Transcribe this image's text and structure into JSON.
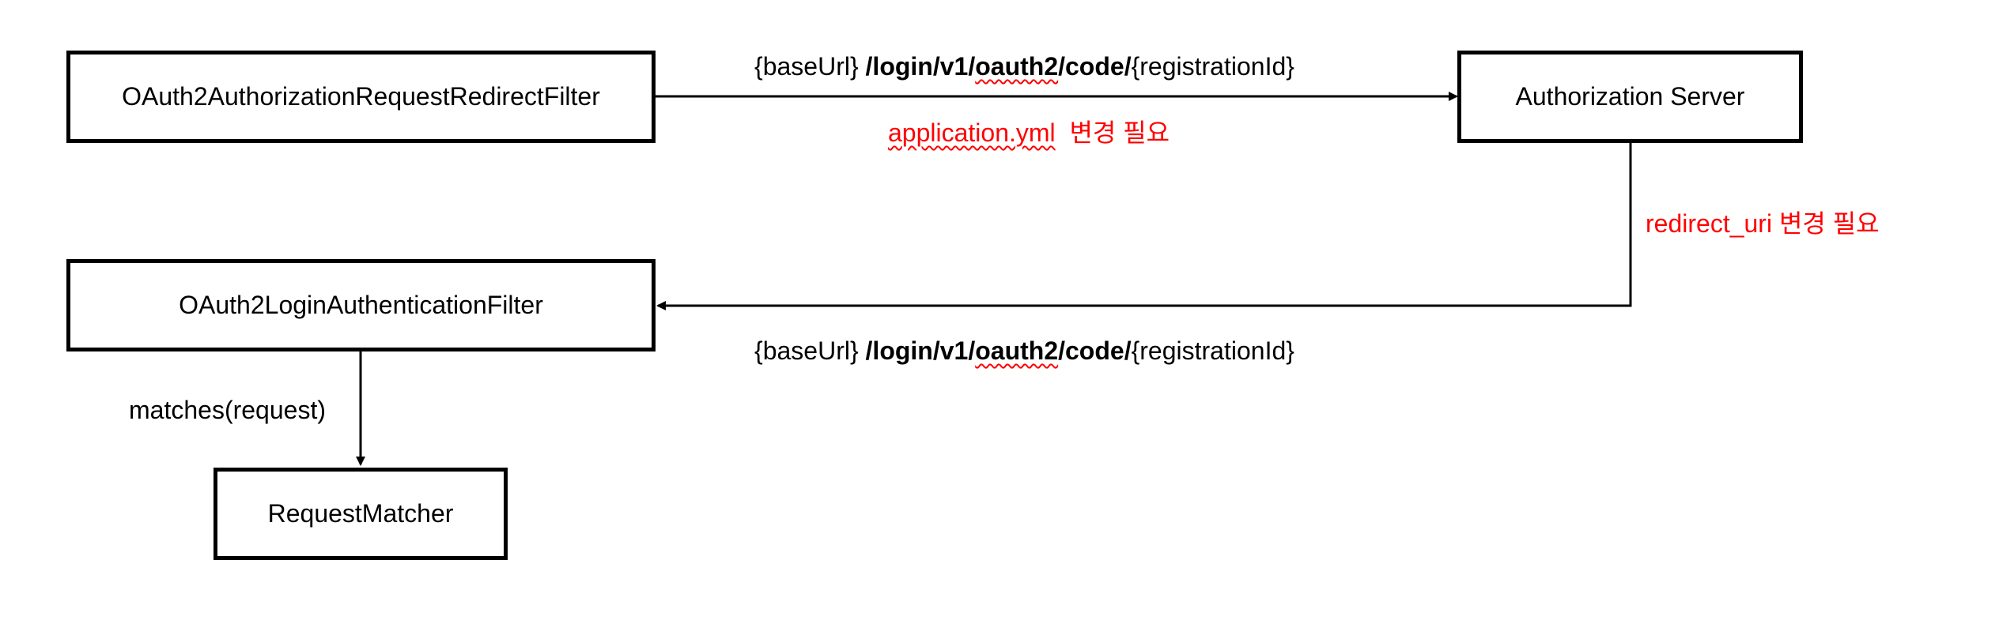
{
  "nodes": {
    "redirect_filter": "OAuth2AuthorizationRequestRedirectFilter",
    "auth_server": "Authorization Server",
    "login_filter": "OAuth2LoginAuthenticationFilter",
    "request_matcher": "RequestMatcher"
  },
  "edges": {
    "top_label": {
      "base": "{baseUrl}",
      "p1": "/login/v1/",
      "p2": "oauth2",
      "p3": "/code/",
      "tail": "{registrationId}"
    },
    "top_note": {
      "file": "application.yml",
      "text": "변경 필요"
    },
    "side_note": "redirect_uri 변경 필요",
    "bottom_label": {
      "base": "{baseUrl}",
      "p1": "/login/v1/",
      "p2": "oauth2",
      "p3": "/code/",
      "tail": "{registrationId}"
    },
    "matches_label": "matches(request)"
  },
  "colors": {
    "annotation": "#ff0000",
    "stroke": "#000000"
  }
}
